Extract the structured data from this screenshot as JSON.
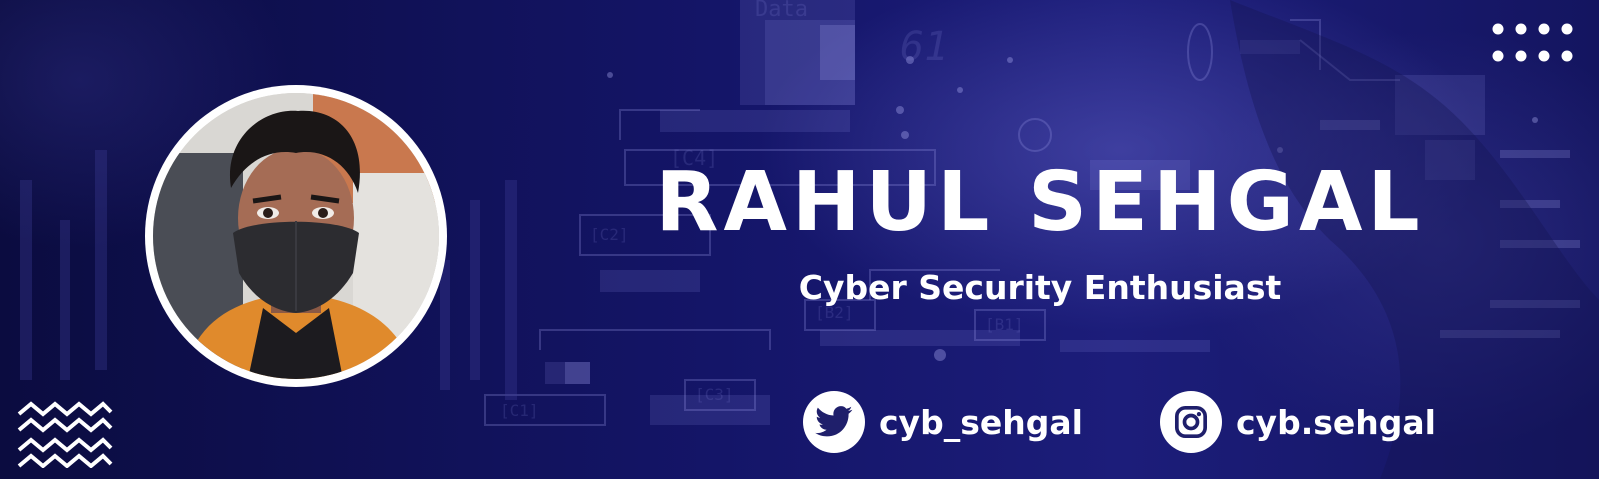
{
  "profile": {
    "name": "RAHUL SEHGAL",
    "title": "Cyber Security Enthusiast"
  },
  "social": {
    "twitter": {
      "icon": "twitter-bird-icon",
      "handle": "cyb_sehgal"
    },
    "instagram": {
      "icon": "instagram-icon",
      "handle": "cyb.sehgal"
    }
  },
  "background": {
    "labels": [
      "Data",
      "[C4]",
      "[C2]",
      "[B2]",
      "[B1]",
      "[C3]",
      "[C1]",
      "61"
    ]
  },
  "colors": {
    "background": "#141568",
    "text": "#ffffff",
    "accent": "#ffffff",
    "icon_blue": "#1f1f6b"
  },
  "decor": {
    "dots_icon": "dot-grid-icon",
    "zigzag_icon": "zigzag-lines-icon"
  }
}
